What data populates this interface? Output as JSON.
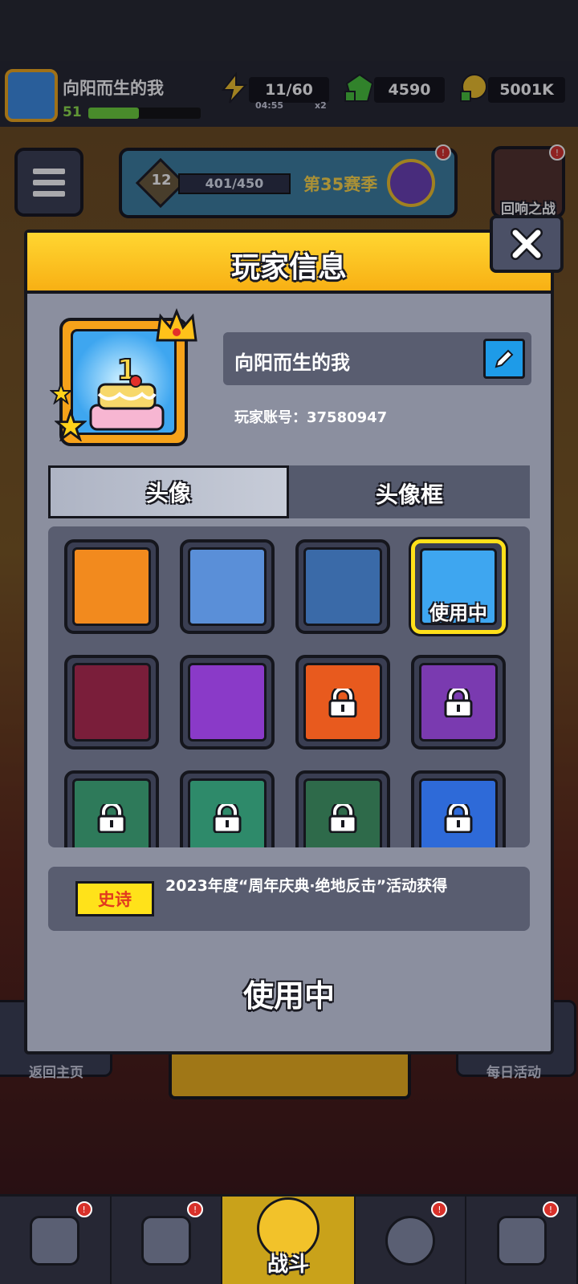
{
  "hud": {
    "player_name": "向阳而生的我",
    "level": "51",
    "xp_fraction": 0.45,
    "energy": "11/60",
    "energy_timer": "04:55",
    "energy_multiplier": "x2",
    "gems": "4590",
    "coins": "5001K"
  },
  "season": {
    "level": "12",
    "progress": "401/450",
    "name": "第35赛季"
  },
  "rival_label": "回响之战",
  "side": {
    "left_label": "返回主页",
    "right_label": "每日活动"
  },
  "bottom_nav": {
    "battle_label": "战斗"
  },
  "modal": {
    "title": "玩家信息",
    "player_name": "向阳而生的我",
    "account_label": "玩家账号：37580947",
    "tabs": [
      {
        "label": "头像",
        "active": true
      },
      {
        "label": "头像框",
        "active": false
      }
    ],
    "selected_badge": "使用中",
    "rarity": "史诗",
    "description": "2023年度“周年庆典·绝地反击”活动获得",
    "status": "使用中"
  },
  "avatars": [
    {
      "name": "goggles-soldier",
      "locked": false,
      "bg": "#f28a1e"
    },
    {
      "name": "zombie-agent",
      "locked": false,
      "bg": "#5a8fd8"
    },
    {
      "name": "boar",
      "locked": false,
      "bg": "#3a6aa8"
    },
    {
      "name": "birthday-cake-1",
      "locked": false,
      "bg": "#3ea6f0",
      "selected": true
    },
    {
      "name": "crowned-soldier",
      "locked": false,
      "bg": "#7a1e3a"
    },
    {
      "name": "birthday-cake-3",
      "locked": false,
      "bg": "#8a3ac8"
    },
    {
      "name": "red-beret",
      "locked": true,
      "bg": "#e85a1e"
    },
    {
      "name": "purple-creature",
      "locked": true,
      "bg": "#7a3ab0"
    },
    {
      "name": "pink-cat",
      "locked": true,
      "bg": "#2e7a5a"
    },
    {
      "name": "pink-star",
      "locked": true,
      "bg": "#2e8a6a"
    },
    {
      "name": "boat-fish",
      "locked": true,
      "bg": "#2e6a4a"
    },
    {
      "name": "pirate",
      "locked": true,
      "bg": "#2e6ad8"
    }
  ],
  "colors": {
    "modal_header": "#f8b014",
    "selected_border": "#ffe01a",
    "rarity_bg": "#ffe21a",
    "rarity_text": "#e23a1e",
    "edit_button": "#1e9be8"
  }
}
